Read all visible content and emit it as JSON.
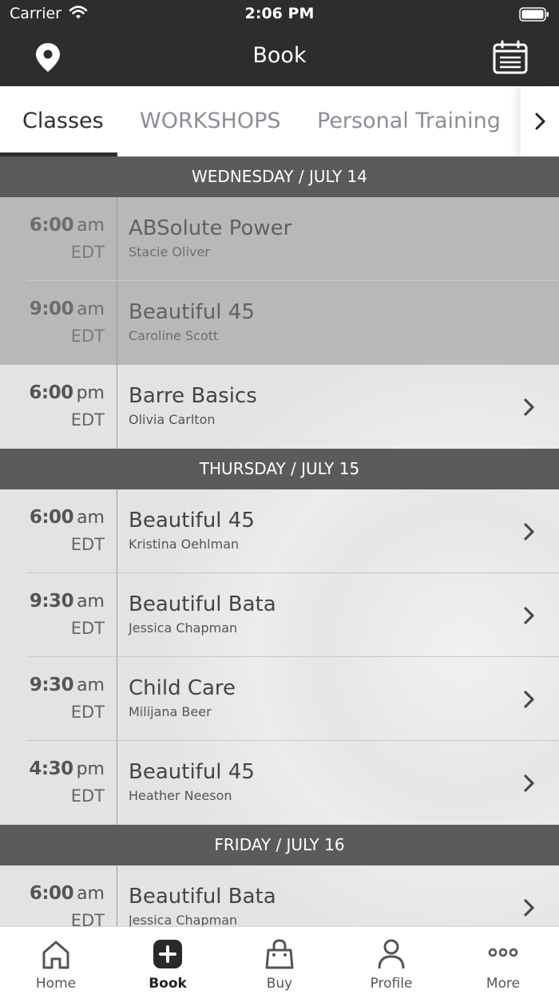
{
  "status": {
    "carrier": "Carrier",
    "time": "2:06 PM"
  },
  "nav": {
    "title": "Book",
    "left_icon": "location-pin-icon",
    "right_icon": "calendar-icon"
  },
  "tabs": [
    {
      "label": "Classes",
      "active": true
    },
    {
      "label": "WORKSHOPS",
      "active": false
    },
    {
      "label": "Personal Training",
      "active": false
    }
  ],
  "days": [
    {
      "header": "WEDNESDAY / JULY 14",
      "classes": [
        {
          "time": "6:00",
          "ampm": "am",
          "tz": "EDT",
          "name": "ABSolute Power",
          "instructor": "Stacie Oliver",
          "available": false
        },
        {
          "time": "9:00",
          "ampm": "am",
          "tz": "EDT",
          "name": "Beautiful 45",
          "instructor": "Caroline Scott",
          "available": false
        },
        {
          "time": "6:00",
          "ampm": "pm",
          "tz": "EDT",
          "name": "Barre Basics",
          "instructor": "Olivia Carlton",
          "available": true
        }
      ]
    },
    {
      "header": "THURSDAY / JULY 15",
      "classes": [
        {
          "time": "6:00",
          "ampm": "am",
          "tz": "EDT",
          "name": "Beautiful 45",
          "instructor": "Kristina Oehlman",
          "available": true
        },
        {
          "time": "9:30",
          "ampm": "am",
          "tz": "EDT",
          "name": "Beautiful Bata",
          "instructor": "Jessica Chapman",
          "available": true
        },
        {
          "time": "9:30",
          "ampm": "am",
          "tz": "EDT",
          "name": "Child Care",
          "instructor": "Milijana Beer",
          "available": true
        },
        {
          "time": "4:30",
          "ampm": "pm",
          "tz": "EDT",
          "name": "Beautiful 45",
          "instructor": "Heather Neeson",
          "available": true
        }
      ]
    },
    {
      "header": "FRIDAY / JULY 16",
      "classes": [
        {
          "time": "6:00",
          "ampm": "am",
          "tz": "EDT",
          "name": "Beautiful Bata",
          "instructor": "Jessica Chapman",
          "available": true
        }
      ]
    }
  ],
  "tabbar": [
    {
      "label": "Home",
      "icon": "home-icon",
      "active": false
    },
    {
      "label": "Book",
      "icon": "plus-square-icon",
      "active": true
    },
    {
      "label": "Buy",
      "icon": "shopping-bag-icon",
      "active": false
    },
    {
      "label": "Profile",
      "icon": "person-icon",
      "active": false
    },
    {
      "label": "More",
      "icon": "more-dots-icon",
      "active": false
    }
  ],
  "colors": {
    "header_dark": "#2d2d2d",
    "day_header": "#5b5b5b",
    "tab_inactive": "#8a8f96"
  }
}
